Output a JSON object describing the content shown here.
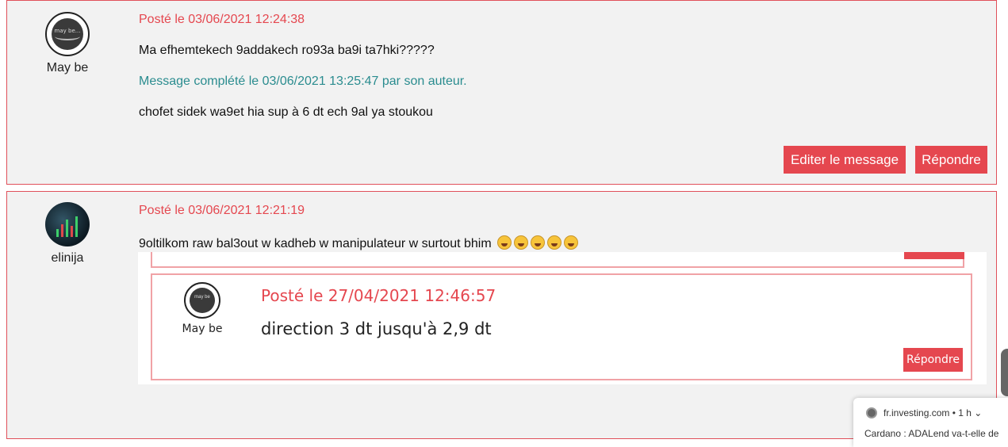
{
  "posts": [
    {
      "author": "May be",
      "date": "Posté le 03/06/2021 12:24:38",
      "text": "Ma efhemtekech 9addakech ro93a ba9i ta7hki?????",
      "edit_note": "Message complété le 03/06/2021 13:25:47 par son auteur.",
      "text2": "chofet sidek wa9et hia sup à 6 dt ech 9al ya stoukou",
      "edit_button": "Editer le message",
      "reply_button": "Répondre"
    },
    {
      "author": "elinija",
      "date": "Posté le 03/06/2021 12:21:19",
      "text": "9oltilkom raw bal3out w kadheb w manipulateur w surtout bhim",
      "quoted": {
        "author": "May be",
        "date": "Posté le 27/04/2021 12:46:57",
        "text": "direction 3 dt jusqu'à 2,9 dt",
        "reply_button": "Répondre"
      }
    }
  ],
  "notification": {
    "source": "fr.investing.com  •  1 h ⌄",
    "title": "Cardano : ADALend va-t-elle de"
  },
  "colors": {
    "accent": "#e5474f",
    "note": "#2a8c8f",
    "post_bg": "#f2f2f2"
  }
}
